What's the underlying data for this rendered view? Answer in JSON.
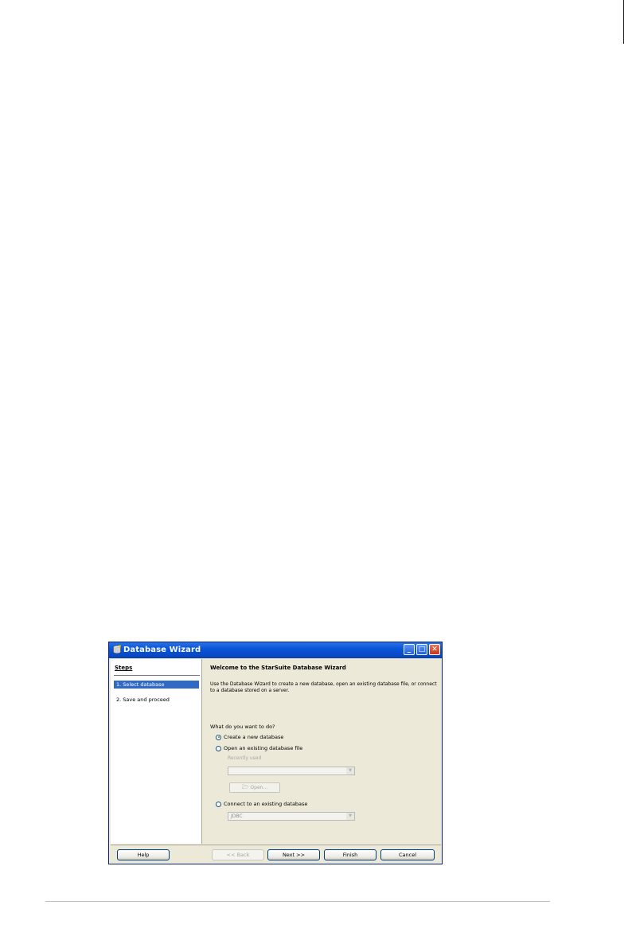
{
  "window": {
    "title": "Database Wizard"
  },
  "steps": {
    "title": "Steps",
    "items": [
      {
        "label": "1.  Select database",
        "selected": true
      },
      {
        "label": "2.  Save and proceed",
        "selected": false
      }
    ]
  },
  "main": {
    "heading": "Welcome to the StarSuite Database Wizard",
    "description": "Use the Database Wizard to create a new database, open an existing database file, or connect to a database stored on a server.",
    "question": "What do you want to do?",
    "options": [
      {
        "label": "Create a new database",
        "checked": true
      },
      {
        "label": "Open an existing database file",
        "checked": false
      },
      {
        "label": "Connect to an existing database",
        "checked": false
      }
    ],
    "recently_used_label": "Recently used",
    "recently_used_value": "",
    "open_button": "Open...",
    "connect_type_value": "JDBC"
  },
  "buttons": {
    "help": "Help",
    "back": "<< Back",
    "next": "Next >>",
    "finish": "Finish",
    "cancel": "Cancel"
  },
  "colors": {
    "titlebar": "#0a55d9",
    "selection": "#316ac5",
    "dialog_bg": "#ece9d8"
  }
}
